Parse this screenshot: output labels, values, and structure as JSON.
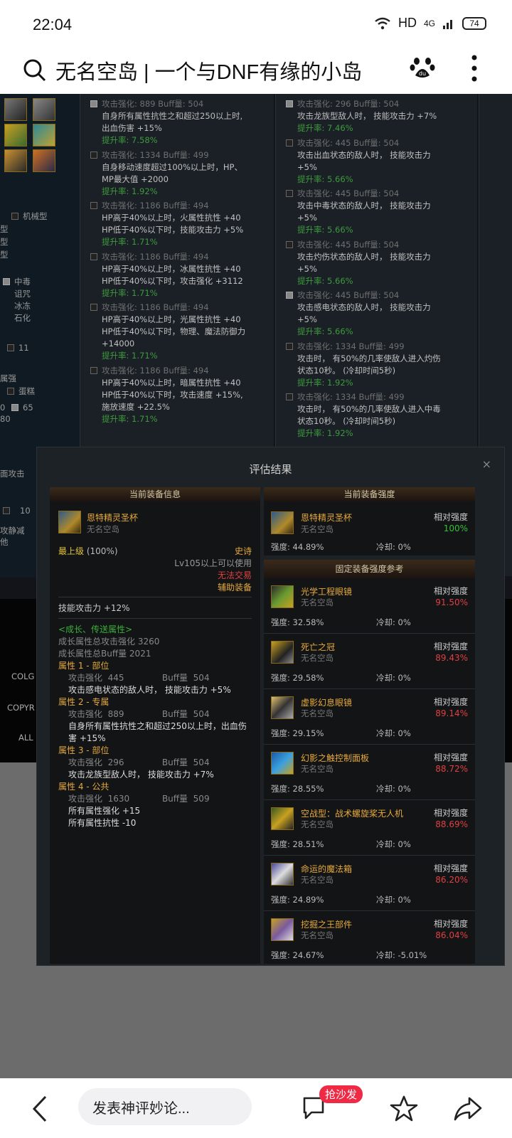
{
  "status": {
    "time": "22:04",
    "hd": "HD",
    "net": "4G",
    "battery": "74"
  },
  "topbar": {
    "title": "无名空岛 | 一个与DNF有缘的小岛"
  },
  "options_col2": [
    {
      "on": true,
      "hd": "攻击强化: 889          Buff量: 504",
      "lines": [
        "自身所有属性抗性之和超过250以上时,",
        "出血伤害 +15%"
      ],
      "rate": "提升率: 7.58%"
    },
    {
      "on": false,
      "hd": "攻击强化: 1334        Buff量: 499",
      "lines": [
        "自身移动速度超过100%以上时，HP、",
        "MP最大值 +2000"
      ],
      "rate": "提升率: 1.92%"
    },
    {
      "on": false,
      "hd": "攻击强化: 1186        Buff量: 494",
      "lines": [
        "HP高于40%以上时，火属性抗性 +40",
        "HP低于40%以下时，技能攻击力 +5%"
      ],
      "rate": "提升率: 1.71%"
    },
    {
      "on": false,
      "hd": "攻击强化: 1186        Buff量: 494",
      "lines": [
        "HP高于40%以上时，冰属性抗性 +40",
        "HP低于40%以下时，攻击强化 +3112"
      ],
      "rate": "提升率: 1.71%"
    },
    {
      "on": false,
      "hd": "攻击强化: 1186        Buff量: 494",
      "lines": [
        "HP高于40%以上时，光属性抗性 +40",
        "HP低于40%以下时，物理、魔法防御力",
        "+14000"
      ],
      "rate": "提升率: 1.71%"
    },
    {
      "on": false,
      "hd": "攻击强化: 1186        Buff量: 494",
      "lines": [
        "HP高于40%以上时，暗属性抗性 +40",
        "HP低于40%以下时，攻击速度 +15%,",
        "施放速度 +22.5%"
      ],
      "rate": "提升率: 1.71%"
    }
  ],
  "options_col3": [
    {
      "on": true,
      "hd": "攻击强化: 296          Buff量: 504",
      "lines": [
        "攻击龙族型敌人时，  技能攻击力 +7%"
      ],
      "rate": "提升率: 7.46%"
    },
    {
      "on": false,
      "hd": "攻击强化: 445          Buff量: 504",
      "lines": [
        "攻击出血状态的敌人时，  技能攻击力",
        "+5%"
      ],
      "rate": "提升率: 5.66%"
    },
    {
      "on": false,
      "hd": "攻击强化: 445          Buff量: 504",
      "lines": [
        "攻击中毒状态的敌人时，  技能攻击力",
        "+5%"
      ],
      "rate": "提升率: 5.66%"
    },
    {
      "on": false,
      "hd": "攻击强化: 445          Buff量: 504",
      "lines": [
        "攻击灼伤状态的敌人时，  技能攻击力",
        "+5%"
      ],
      "rate": "提升率: 5.66%"
    },
    {
      "on": true,
      "hd": "攻击强化: 445          Buff量: 504",
      "lines": [
        "攻击感电状态的敌人时，  技能攻击力",
        "+5%"
      ],
      "rate": "提升率: 5.66%"
    },
    {
      "on": false,
      "hd": "攻击强化: 1334        Buff量: 499",
      "lines": [
        "攻击时，  有50%的几率使敌人进入灼伤",
        "状态10秒。 (冷却时间5秒)"
      ],
      "rate": "提升率: 1.92%"
    },
    {
      "on": false,
      "hd": "攻击强化: 1334        Buff量: 499",
      "lines": [
        "攻击时，  有50%的几率使敌人进入中毒",
        "状态10秒。 (冷却时间5秒)"
      ],
      "rate": "提升率: 1.92%"
    }
  ],
  "sidebar": {
    "mech": "机械型",
    "t1": "型",
    "t2": "型",
    "t3": "型",
    "poison": "中毒",
    "curse": "诅咒",
    "freeze": "冰冻",
    "stone": "石化",
    "n11": "11",
    "dmg": "属强",
    "cake": "蛋糕",
    "n0": "0",
    "n65": "65",
    "n80": "80",
    "front": "面攻击",
    "n10": "10",
    "slow": "攻静减",
    "other": "他"
  },
  "footer": {
    "l1": "COLG",
    "l2": "COPYR",
    "l3": "ALL"
  },
  "modal": {
    "title": "评估结果",
    "left_head": "当前装备信息",
    "item_name": "恩特精灵圣杯",
    "item_sub": "无名空岛",
    "grade": "最上级",
    "grade_pct": "(100%)",
    "rarity": "史诗",
    "req": "Lv105以上可以使用",
    "trade": "无法交易",
    "type": "辅助装备",
    "skill": "技能攻击力 +12%",
    "growth_head": "<成长、传送属性>",
    "growth1": "成长属性总攻击强化 3260",
    "growth2": "成长属性总Buff量 2021",
    "attrs": [
      {
        "title": "属性 1 - 部位",
        "stat": "攻击强化  445              Buff量  504",
        "desc": [
          "攻击感电状态的敌人时，  技能攻击力 +5%"
        ]
      },
      {
        "title": "属性 2 - 专属",
        "stat": "攻击强化  889              Buff量  504",
        "desc": [
          "自身所有属性抗性之和超过250以上时，出血伤",
          "害 +15%"
        ]
      },
      {
        "title": "属性 3 - 部位",
        "stat": "攻击强化  296              Buff量  504",
        "desc": [
          "攻击龙族型敌人时，  技能攻击力 +7%"
        ]
      },
      {
        "title": "属性 4 - 公共",
        "stat": "攻击强化  1630            Buff量  509",
        "desc": [
          "所有属性强化 +15",
          "所有属性抗性 -10"
        ]
      }
    ],
    "right_head": "当前装备强度",
    "cur": {
      "name": "恩特精灵圣杯",
      "sub": "无名空岛",
      "rel_label": "相对强度",
      "rel": "100%",
      "strength": "强度: 44.89%",
      "cd": "冷却: 0%"
    },
    "ref_head": "固定装备强度参考",
    "refs": [
      {
        "name": "光学工程眼镜",
        "sub": "无名空岛",
        "rel_label": "相对强度",
        "rel": "91.50%",
        "strength": "强度: 32.58%",
        "cd": "冷却: 0%"
      },
      {
        "name": "死亡之冠",
        "sub": "无名空岛",
        "rel_label": "相对强度",
        "rel": "89.43%",
        "strength": "强度: 29.58%",
        "cd": "冷却: 0%"
      },
      {
        "name": "虚影幻息眼镜",
        "sub": "无名空岛",
        "rel_label": "相对强度",
        "rel": "89.14%",
        "strength": "强度: 29.15%",
        "cd": "冷却: 0%"
      },
      {
        "name": "幻影之触控制面板",
        "sub": "无名空岛",
        "rel_label": "相对强度",
        "rel": "88.72%",
        "strength": "强度: 28.55%",
        "cd": "冷却: 0%"
      },
      {
        "name": "空战型：战术螺旋桨无人机",
        "sub": "无名空岛",
        "rel_label": "相对强度",
        "rel": "88.69%",
        "strength": "强度: 28.51%",
        "cd": "冷却: 0%"
      },
      {
        "name": "命运的魔法箱",
        "sub": "无名空岛",
        "rel_label": "相对强度",
        "rel": "86.20%",
        "strength": "强度: 24.89%",
        "cd": "冷却: 0%"
      },
      {
        "name": "挖掘之王部件",
        "sub": "无名空岛",
        "rel_label": "相对强度",
        "rel": "86.04%",
        "strength": "强度: 24.67%",
        "cd": "冷却: -5.01%"
      }
    ]
  },
  "bottombar": {
    "comment_placeholder": "发表神评妙论...",
    "badge": "抢沙发"
  }
}
